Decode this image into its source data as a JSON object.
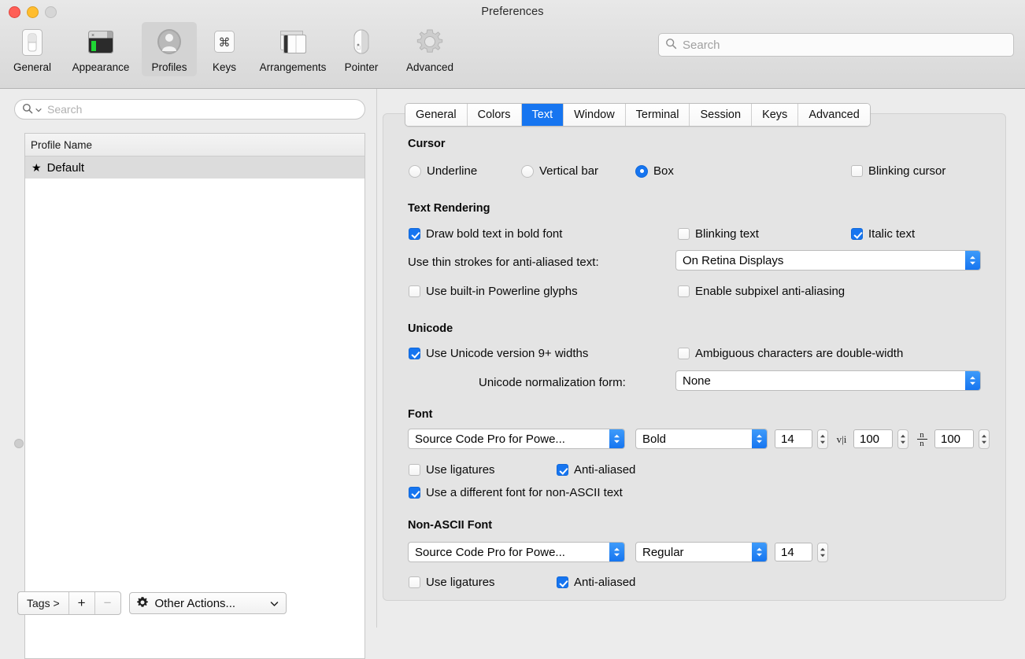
{
  "window": {
    "title": "Preferences",
    "traffic_lights": [
      "close",
      "minimize",
      "zoom"
    ]
  },
  "toolbar": {
    "items": [
      {
        "label": "General",
        "icon": "general-switch-icon",
        "selected": false
      },
      {
        "label": "Appearance",
        "icon": "appearance-terminal-icon",
        "selected": false
      },
      {
        "label": "Profiles",
        "icon": "profiles-person-icon",
        "selected": true
      },
      {
        "label": "Keys",
        "icon": "keys-command-icon",
        "selected": false
      },
      {
        "label": "Arrangements",
        "icon": "arrangements-windows-icon",
        "selected": false
      },
      {
        "label": "Pointer",
        "icon": "pointer-mouse-icon",
        "selected": false
      },
      {
        "label": "Advanced",
        "icon": "advanced-gear-icon",
        "selected": false
      }
    ],
    "search": {
      "placeholder": "Search",
      "value": ""
    }
  },
  "sidebar": {
    "search": {
      "placeholder": "Search",
      "value": ""
    },
    "table": {
      "column_header": "Profile Name",
      "rows": [
        {
          "name": "Default",
          "starred": true,
          "selected": true
        }
      ]
    },
    "bottom_bar": {
      "tags_label": "Tags >",
      "add_label": "+",
      "remove_label": "−",
      "other_actions_label": "Other Actions..."
    }
  },
  "tabs": [
    {
      "label": "General",
      "active": false
    },
    {
      "label": "Colors",
      "active": false
    },
    {
      "label": "Text",
      "active": true
    },
    {
      "label": "Window",
      "active": false
    },
    {
      "label": "Terminal",
      "active": false
    },
    {
      "label": "Session",
      "active": false
    },
    {
      "label": "Keys",
      "active": false
    },
    {
      "label": "Advanced",
      "active": false
    }
  ],
  "text_tab": {
    "cursor": {
      "title": "Cursor",
      "options": [
        {
          "label": "Underline",
          "selected": false
        },
        {
          "label": "Vertical bar",
          "selected": false
        },
        {
          "label": "Box",
          "selected": true
        }
      ],
      "blinking_cursor": {
        "label": "Blinking cursor",
        "checked": false
      }
    },
    "text_rendering": {
      "title": "Text Rendering",
      "draw_bold": {
        "label": "Draw bold text in bold font",
        "checked": true
      },
      "blinking_text": {
        "label": "Blinking text",
        "checked": false
      },
      "italic_text": {
        "label": "Italic text",
        "checked": true
      },
      "thin_strokes_label": "Use thin strokes for anti-aliased text:",
      "thin_strokes_value": "On Retina Displays",
      "powerline": {
        "label": "Use built-in Powerline glyphs",
        "checked": false
      },
      "subpixel": {
        "label": "Enable subpixel anti-aliasing",
        "checked": false
      }
    },
    "unicode": {
      "title": "Unicode",
      "version9": {
        "label": "Use Unicode version 9+ widths",
        "checked": true
      },
      "ambiguous": {
        "label": "Ambiguous characters are double-width",
        "checked": false
      },
      "normalization_label": "Unicode normalization form:",
      "normalization_value": "None"
    },
    "font": {
      "title": "Font",
      "family": "Source Code Pro for Powe...",
      "style": "Bold",
      "size": "14",
      "horizontal_spacing": {
        "icon": "horizontal-spacing-icon",
        "value": "100"
      },
      "vertical_spacing": {
        "icon": "vertical-spacing-icon",
        "value": "100"
      },
      "ligatures": {
        "label": "Use ligatures",
        "checked": false
      },
      "antialiased": {
        "label": "Anti-aliased",
        "checked": true
      },
      "different_font_non_ascii": {
        "label": "Use a different font for non-ASCII text",
        "checked": true
      }
    },
    "non_ascii_font": {
      "title": "Non-ASCII Font",
      "family": "Source Code Pro for Powe...",
      "style": "Regular",
      "size": "14",
      "ligatures": {
        "label": "Use ligatures",
        "checked": false
      },
      "antialiased": {
        "label": "Anti-aliased",
        "checked": true
      }
    }
  },
  "colors": {
    "accent": "#1675f0",
    "window_bg": "#ececec",
    "panel_bg": "#e4e4e4"
  }
}
